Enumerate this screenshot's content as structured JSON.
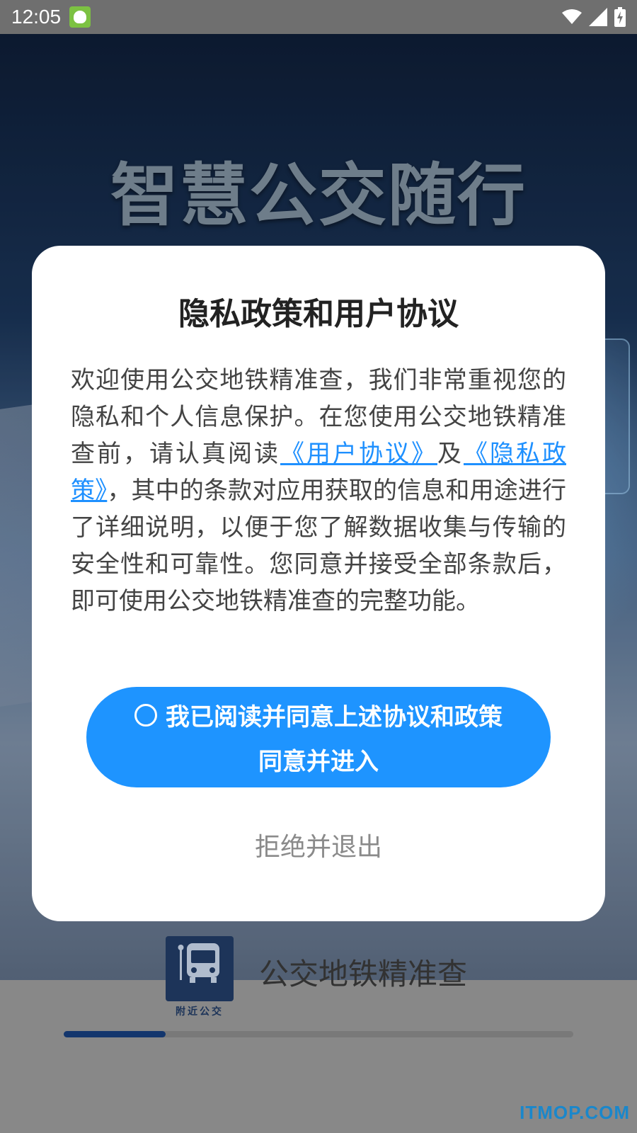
{
  "status_bar": {
    "time": "12:05",
    "icons": [
      "app-notification-icon",
      "wifi-icon",
      "signal-icon",
      "battery-charging-icon"
    ]
  },
  "splash": {
    "title": "智慧公交随行",
    "brand_name": "公交地铁精准查",
    "logo_text": "附近公交",
    "progress": 0.2,
    "watermark": "ITMOP.COM"
  },
  "dialog": {
    "title": "隐私政策和用户协议",
    "body_part1": "欢迎使用公交地铁精准查，我们非常重视您的隐私和个人信息保护。在您使用公交地铁精准查前，请认真阅读",
    "user_agreement_link": "《用户协议》",
    "body_and": "及",
    "privacy_policy_link": "《隐私政策》",
    "body_part2": "，其中的条款对应用获取的信息和用途进行了详细说明，以便于您了解数据收集与传输的安全性和可靠性。您同意并接受全部条款后，即可使用公交地铁精准查的完整功能。",
    "agree_checkbox_label": "我已阅读并同意上述协议和政策",
    "agree_button_label": "同意并进入",
    "reject_button_label": "拒绝并退出"
  },
  "colors": {
    "primary": "#1e94ff",
    "link": "#1e90ff",
    "progress": "#163e7d"
  }
}
